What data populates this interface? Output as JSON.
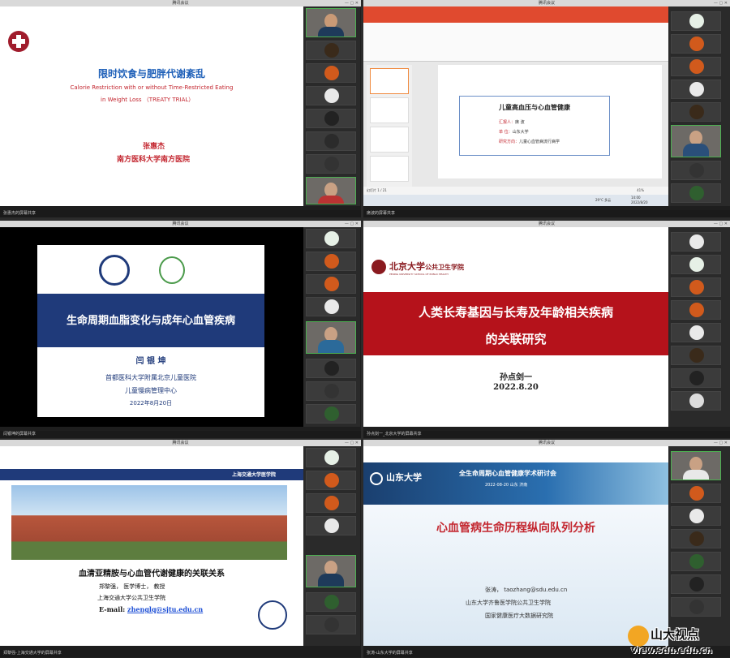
{
  "window_title": "腾讯会议",
  "panels": [
    {
      "id": "p1",
      "footer": "张惠杰的屏幕共享",
      "slide": {
        "title": "限时饮食与肥胖代谢紊乱",
        "subtitle_line1": "Calorie Restriction with or without Time-Restricted Eating",
        "subtitle_line2": "in Weight Loss （TREATY TRIAL）",
        "speaker": "张惠杰",
        "org": "南方医科大学南方医院"
      }
    },
    {
      "id": "p2",
      "footer": "席波的屏幕共享",
      "slide": {
        "title": "儿童高血压与心血管健康",
        "rows": [
          [
            "汇报人：",
            "席 波"
          ],
          [
            "单  位：",
            "山东大学"
          ],
          [
            "研究方向：",
            "儿童心血管病流行病学"
          ]
        ],
        "status": "幻灯片 1 / 21",
        "zoom": "41%",
        "time": "14:00",
        "date": "2022/8/20",
        "weather": "29°C 多云"
      }
    },
    {
      "id": "p3",
      "footer": "闫银坤的屏幕共享",
      "slide": {
        "title": "生命周期血脂变化与成年心血管疾病",
        "speaker": "闫 银 坤",
        "org": "首都医科大学附属北京儿童医院",
        "dept": "儿童慢病管理中心",
        "date": "2022年8月20日"
      }
    },
    {
      "id": "p4",
      "footer": "孙点剑一_北京大学的屏幕共享",
      "slide": {
        "school": "北京大学",
        "school_sub": "公共卫生学院",
        "school_en": "PEKING UNIVERSITY SCHOOL OF PUBLIC HEALTH",
        "title_line1": "人类长寿基因与长寿及年龄相关疾病",
        "title_line2": "的关联研究",
        "speaker": "孙点剑一",
        "date": "2022.8.20"
      }
    },
    {
      "id": "p5",
      "footer": "郑黎强-上海交通大学的屏幕共享",
      "slide": {
        "school": "上海交通大学医学院",
        "title": "血清亚精胺与心血管代谢健康的关联关系",
        "speaker": "郑黎强， 医学博士， 教授",
        "org": "上海交通大学公共卫生学院",
        "email_label": "E-mail:",
        "email": "zhenglq@sjtu.edu.cn"
      }
    },
    {
      "id": "p6",
      "footer": "张涛-山东大学的屏幕共享",
      "slide": {
        "school": "山东大学",
        "conf": "全生命周期心血管健康学术研讨会",
        "conf_date": "2022-08-20  山东 济南",
        "title": "心血管病生命历程纵向队列分析",
        "speaker": "张涛， taozhang@sdu.edu.cn",
        "org1": "山东大学齐鲁医学院公共卫生学院",
        "org2": "国家健康医疗大数据研究院"
      }
    }
  ],
  "watermark": {
    "name": "山大视点",
    "url": "view.sdu.edu.cn"
  },
  "colors": {
    "red": "#b5121b",
    "navy": "#1f3a7a",
    "teal": "#2a7fb8"
  }
}
